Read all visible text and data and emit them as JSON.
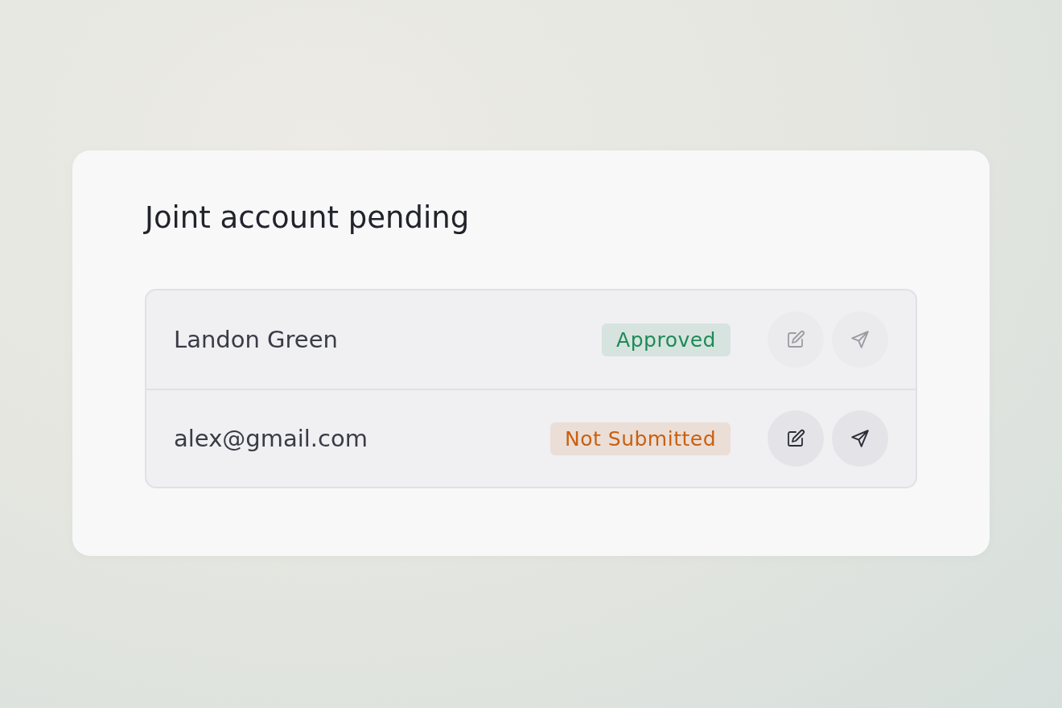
{
  "card": {
    "title": "Joint account pending",
    "members": [
      {
        "name": "Landon Green",
        "status": {
          "label": "Approved",
          "color": "#1f8a55"
        },
        "actions_disabled": true
      },
      {
        "name": "alex@gmail.com",
        "status": {
          "label": "Not Submitted",
          "color": "#c9600f"
        },
        "actions_disabled": false
      }
    ]
  }
}
